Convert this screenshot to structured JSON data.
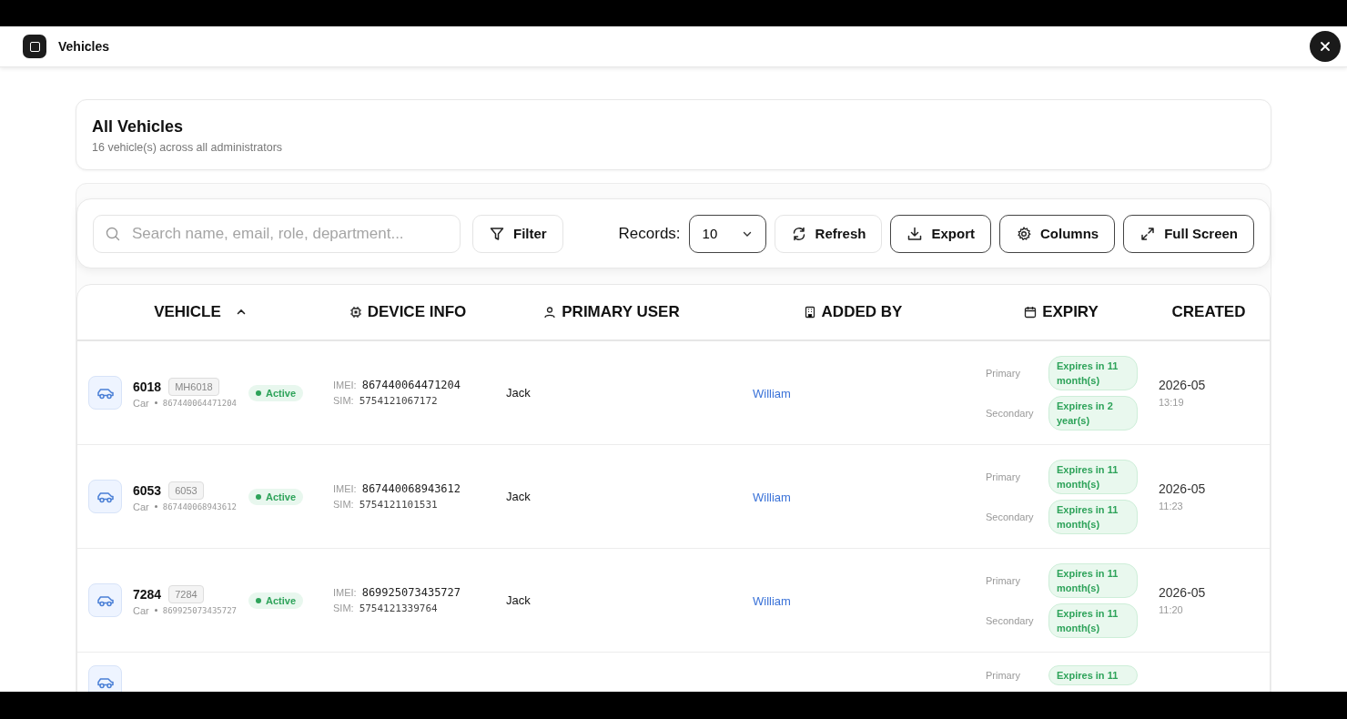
{
  "window": {
    "title": "Vehicles"
  },
  "summary": {
    "title": "All Vehicles",
    "subtitle": "16 vehicle(s) across all administrators"
  },
  "toolbar": {
    "search": {
      "placeholder": "Search name, email, role, department..."
    },
    "filter": "Filter",
    "records_label": "Records:",
    "records_value": "10",
    "buttons": [
      {
        "kind": "refresh",
        "label": "Refresh"
      },
      {
        "kind": "export",
        "label": "Export"
      },
      {
        "kind": "columns",
        "label": "Columns"
      },
      {
        "kind": "fullscreen",
        "label": "Full Screen"
      }
    ]
  },
  "table": {
    "columns": [
      {
        "kind": "vehicle",
        "label": "VEHICLE",
        "sorted": true
      },
      {
        "kind": "device",
        "label": "DEVICE INFO",
        "sorted": false
      },
      {
        "kind": "user",
        "label": "PRIMARY USER",
        "sorted": false
      },
      {
        "kind": "added",
        "label": "ADDED BY",
        "sorted": false
      },
      {
        "kind": "expiry",
        "label": "EXPIRY",
        "sorted": false
      },
      {
        "kind": "created",
        "label": "CREATED",
        "sorted": false
      }
    ],
    "rows": [
      {
        "name": "6018",
        "plate": "MH6018",
        "type": "Car",
        "device": "867440064471204",
        "status": "Active",
        "imei_label": "IMEI:",
        "imei": "867440064471204",
        "sim_label": "SIM:",
        "sim": "5754121067172",
        "user": "Jack",
        "added_by": "William",
        "expiry": [
          {
            "label": "Primary",
            "text": "Expires in 11 month(s)"
          },
          {
            "label": "Secondary",
            "text": "Expires in 2 year(s)"
          }
        ],
        "date": "2026-05",
        "time": "13:19"
      },
      {
        "name": "6053",
        "plate": "6053",
        "type": "Car",
        "device": "867440068943612",
        "status": "Active",
        "imei_label": "IMEI:",
        "imei": "867440068943612",
        "sim_label": "SIM:",
        "sim": "5754121101531",
        "user": "Jack",
        "added_by": "William",
        "expiry": [
          {
            "label": "Primary",
            "text": "Expires in 11 month(s)"
          },
          {
            "label": "Secondary",
            "text": "Expires in 11 month(s)"
          }
        ],
        "date": "2026-05",
        "time": "11:23"
      },
      {
        "name": "7284",
        "plate": "7284",
        "type": "Car",
        "device": "869925073435727",
        "status": "Active",
        "imei_label": "IMEI:",
        "imei": "869925073435727",
        "sim_label": "SIM:",
        "sim": "5754121339764",
        "user": "Jack",
        "added_by": "William",
        "expiry": [
          {
            "label": "Primary",
            "text": "Expires in 11 month(s)"
          },
          {
            "label": "Secondary",
            "text": "Expires in 11 month(s)"
          }
        ],
        "date": "2026-05",
        "time": "11:20"
      },
      {
        "expiry": [
          {
            "label": "Primary",
            "text": "Expires in 11"
          }
        ]
      }
    ]
  }
}
